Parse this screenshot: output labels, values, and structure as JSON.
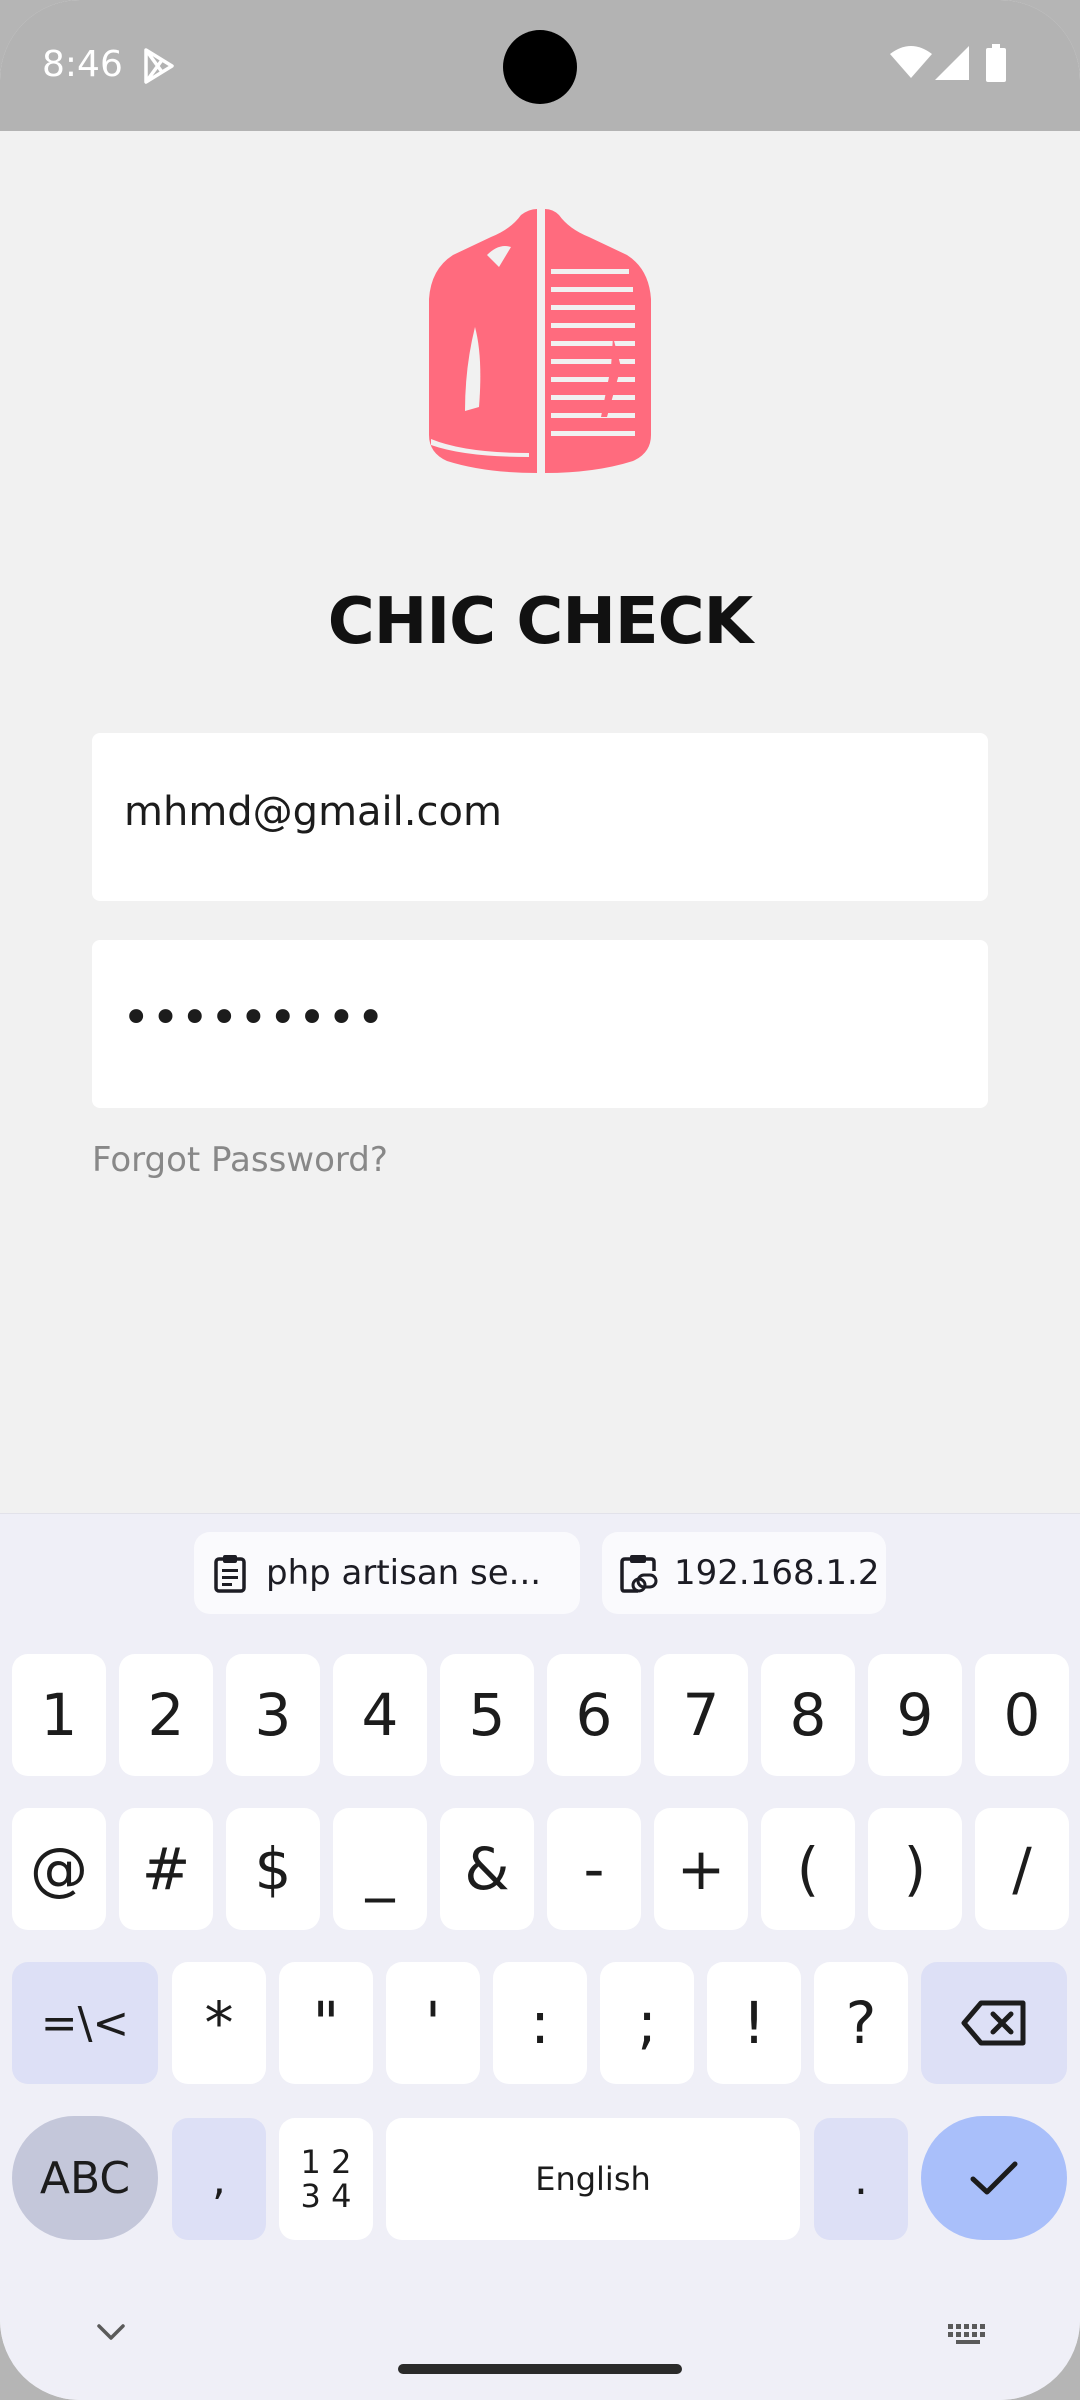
{
  "status_bar": {
    "time": "8:46",
    "icons": [
      "play-store-icon",
      "wifi-icon",
      "signal-icon",
      "battery-icon"
    ]
  },
  "app": {
    "title": "CHIC CHECK",
    "logo": "jacket-logo",
    "brand_color": "#ff6b7e",
    "email_value": "mhmd@gmail.com",
    "password_value": "•••••••••",
    "forgot_label": "Forgot Password?"
  },
  "keyboard": {
    "clipboard_chips": [
      {
        "label": "php artisan se...",
        "icon": "clipboard-icon"
      },
      {
        "label": "192.168.1.2",
        "icon": "clipboard-link-icon"
      }
    ],
    "row1": [
      "1",
      "2",
      "3",
      "4",
      "5",
      "6",
      "7",
      "8",
      "9",
      "0"
    ],
    "row2": [
      "@",
      "#",
      "$",
      "_",
      "&",
      "-",
      "+",
      "(",
      ")",
      "/"
    ],
    "row3": [
      "=\\<",
      "*",
      "\"",
      "'",
      ":",
      ";",
      "!",
      "?"
    ],
    "abc_label": "ABC",
    "comma_label": ",",
    "numpad_label_top": "1 2",
    "numpad_label_bottom": "3 4",
    "space_label": "English",
    "period_label": ".",
    "accent_color": "#dde0f6",
    "enter_color": "#a9bffa"
  }
}
